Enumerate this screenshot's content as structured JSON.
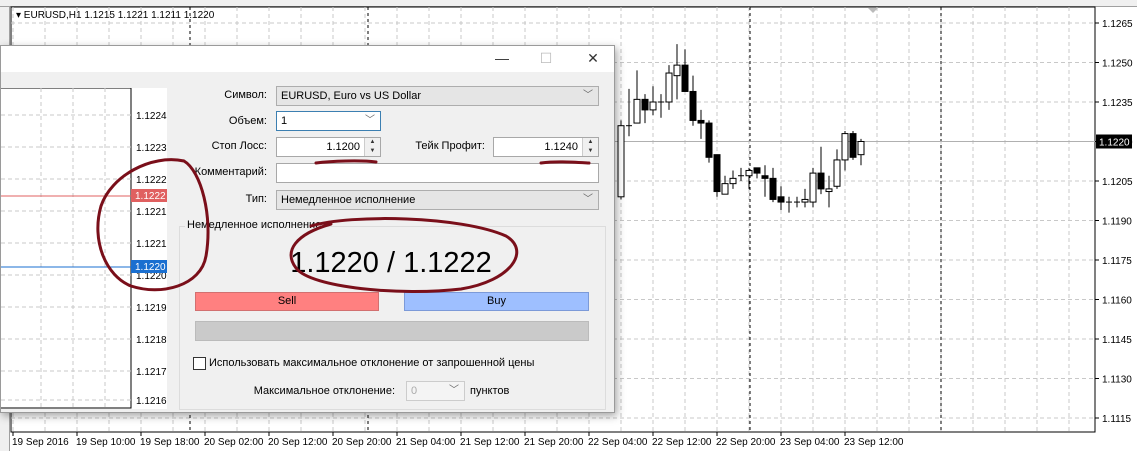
{
  "chart": {
    "title": "▾ EURUSD,H1  1.1215 1.1221 1.1211 1.1220",
    "price_labels": [
      "1.1265",
      "1.1250",
      "1.1235",
      "1.1220",
      "1.1205",
      "1.1190",
      "1.1175",
      "1.1160",
      "1.1145",
      "1.1130",
      "1.1115"
    ],
    "current_price": "1.1220",
    "time_labels": [
      "19 Sep 2016",
      "19 Sep 10:00",
      "19 Sep 18:00",
      "20 Sep 02:00",
      "20 Sep 12:00",
      "20 Sep 20:00",
      "21 Sep 04:00",
      "21 Sep 12:00",
      "21 Sep 20:00",
      "22 Sep 04:00",
      "22 Sep 12:00",
      "22 Sep 20:00",
      "23 Sep 04:00",
      "23 Sep 12:00"
    ]
  },
  "chart_data": {
    "type": "candlestick",
    "symbol": "EURUSD,H1",
    "ylim": [
      1.1108,
      1.1272
    ],
    "first_candle_time": "22 Sep 04:00",
    "candles": [
      [
        1.1199,
        1.1228,
        1.1198,
        1.1226
      ],
      [
        1.1226,
        1.124,
        1.1222,
        1.1226
      ],
      [
        1.1227,
        1.1247,
        1.1227,
        1.1236
      ],
      [
        1.1236,
        1.1238,
        1.1227,
        1.1232
      ],
      [
        1.1232,
        1.1241,
        1.123,
        1.1235
      ],
      [
        1.1235,
        1.1238,
        1.1229,
        1.1235
      ],
      [
        1.1235,
        1.1249,
        1.1232,
        1.1246
      ],
      [
        1.1245,
        1.1257,
        1.1236,
        1.1249
      ],
      [
        1.1249,
        1.1255,
        1.1239,
        1.1239
      ],
      [
        1.1239,
        1.1245,
        1.1226,
        1.1228
      ],
      [
        1.1228,
        1.1232,
        1.1221,
        1.1227
      ],
      [
        1.1227,
        1.1228,
        1.1212,
        1.1214
      ],
      [
        1.1215,
        1.1215,
        1.1199,
        1.1201
      ],
      [
        1.12,
        1.1207,
        1.12,
        1.1204
      ],
      [
        1.1204,
        1.1209,
        1.1202,
        1.1206
      ],
      [
        1.1207,
        1.121,
        1.1205,
        1.1207
      ],
      [
        1.1207,
        1.121,
        1.1202,
        1.1209
      ],
      [
        1.121,
        1.121,
        1.1206,
        1.1208
      ],
      [
        1.1207,
        1.1211,
        1.1199,
        1.1206
      ],
      [
        1.1206,
        1.121,
        1.1197,
        1.1198
      ],
      [
        1.1199,
        1.1203,
        1.1194,
        1.1197
      ],
      [
        1.1197,
        1.1199,
        1.1193,
        1.1197
      ],
      [
        1.1197,
        1.1199,
        1.1195,
        1.1197
      ],
      [
        1.1197,
        1.1202,
        1.1195,
        1.1198
      ],
      [
        1.1197,
        1.121,
        1.1195,
        1.1208
      ],
      [
        1.1208,
        1.1218,
        1.12,
        1.1202
      ],
      [
        1.1201,
        1.1207,
        1.1195,
        1.1202
      ],
      [
        1.1203,
        1.1217,
        1.1202,
        1.1213
      ],
      [
        1.1213,
        1.1224,
        1.1209,
        1.1223
      ],
      [
        1.1223,
        1.1224,
        1.1213,
        1.1214
      ],
      [
        1.1215,
        1.1221,
        1.1211,
        1.122
      ]
    ]
  },
  "dialog": {
    "title_controls": {
      "minimize": "—",
      "maximize": "☐",
      "close": "✕"
    },
    "tick_chart": {
      "labels": [
        "1.1224",
        "1.1223",
        "1.1222",
        "1.1221",
        "1.1221",
        "1.1220",
        "1.1219",
        "1.1218",
        "1.1217",
        "1.1216"
      ],
      "ask": "1.1222",
      "bid": "1.1220"
    },
    "symbol_label": "Символ:",
    "symbol_value": "EURUSD, Euro vs US Dollar",
    "volume_label": "Объем:",
    "volume_value": "1",
    "stoploss_label": "Стоп Лосс:",
    "stoploss_value": "1.1200",
    "takeprofit_label": "Тейк Профит:",
    "takeprofit_value": "1.1240",
    "comment_label": "Комментарий:",
    "comment_value": "",
    "type_label": "Тип:",
    "type_value": "Немедленное исполнение",
    "group_label": "Немедленное исполнение",
    "quote": "1.1220 / 1.1222",
    "sell_label": "Sell",
    "buy_label": "Buy",
    "deviation_checkbox_label": "Использовать максимальное отклонение от запрошенной цены",
    "max_deviation_label": "Максимальное отклонение:",
    "max_deviation_value": "0",
    "points_label": "пунктов",
    "colors": {
      "sell": "#ff8080",
      "buy": "#9ebfff",
      "ask_line": "#e06060",
      "bid_line": "#1a6fd0",
      "annotation": "#7a0f1a"
    }
  }
}
